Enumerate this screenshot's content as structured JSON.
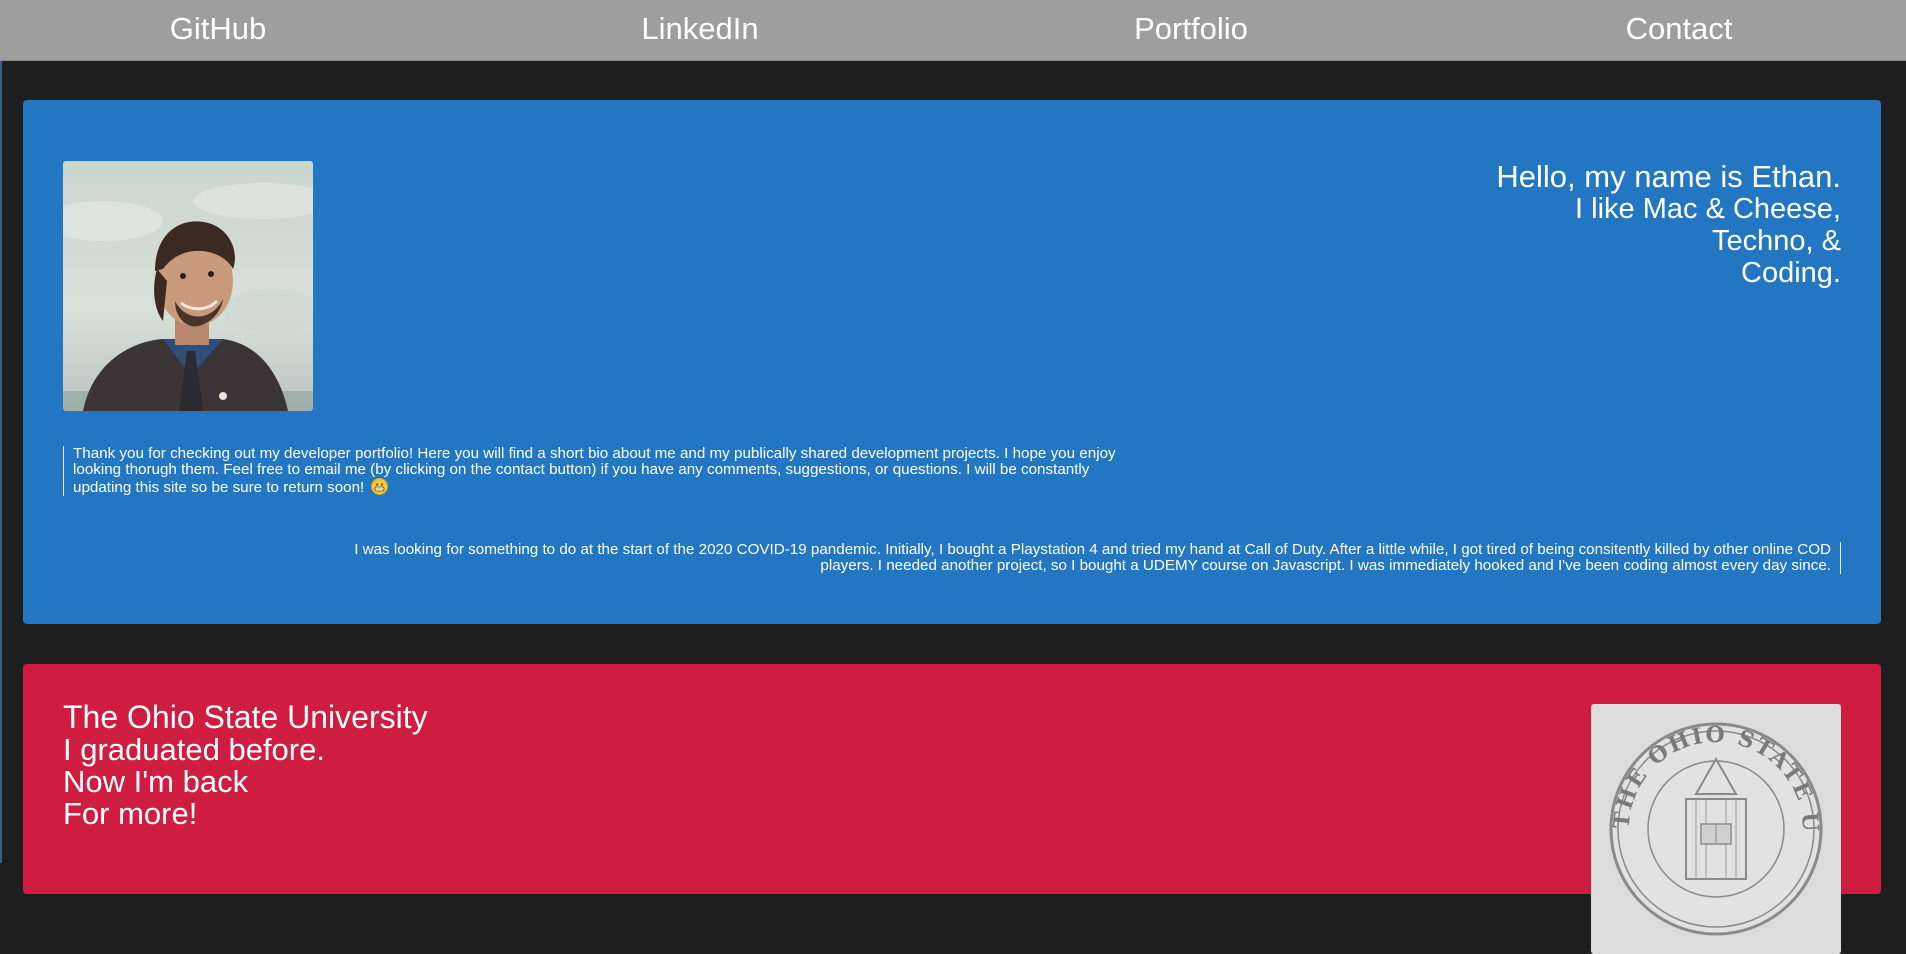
{
  "nav": {
    "links": [
      {
        "label": "GitHub"
      },
      {
        "label": "LinkedIn"
      },
      {
        "label": "Portfolio"
      },
      {
        "label": "Contact"
      }
    ]
  },
  "intro": {
    "hello_title": "Hello, my name is Ethan.",
    "hello_lines": [
      "I like Mac & Cheese,",
      "Techno, &",
      "Coding."
    ],
    "bio_line1": "Thank you for checking out my developer portfolio! Here you will find a short bio about me and my publically shared development projects. I hope you enjoy",
    "bio_line2": "looking thorugh them. Feel free to email me (by clicking on the contact button) if you have any comments, suggestions, or questions. I will be constantly",
    "bio_line3": "updating this site so be sure to return soon!",
    "story_line1": "I was looking for something to do at the start of the 2020 COVID-19 pandemic. Initially, I bought a Playstation 4 and tried my hand at Call of Duty. After a little while, I got tired of being consitently killed by other online COD",
    "story_line2": "players. I needed another project, so I bought a UDEMY course on Javascript. I was immediately hooked and I've been coding almost every day since."
  },
  "osu": {
    "title": "The Ohio State University",
    "lines": [
      "I graduated before.",
      "Now I'm back",
      "For more!"
    ],
    "seal_text": "THE OHIO STATE UNIVERSITY"
  },
  "colors": {
    "nav_bg": "#9e9e9e",
    "page_bg": "#1e1e1e",
    "intro_card": "#2276c2",
    "osu_card": "#cf1d3f"
  }
}
